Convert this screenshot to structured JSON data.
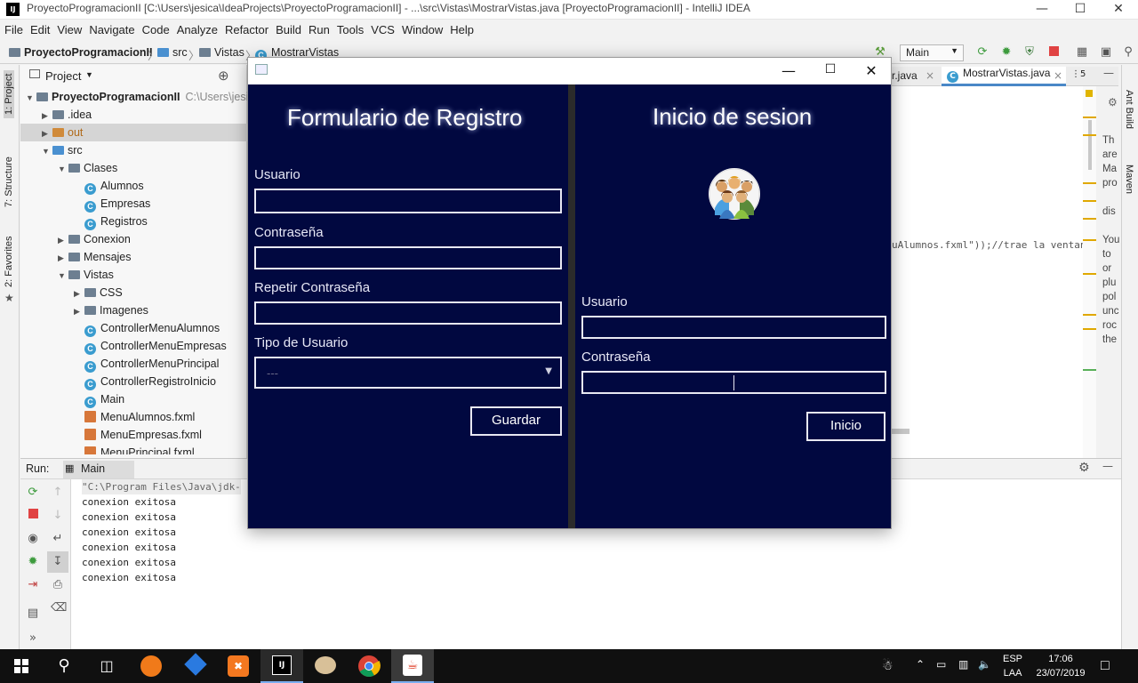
{
  "window": {
    "title": "ProyectoProgramacionII [C:\\Users\\jesica\\IdeaProjects\\ProyectoProgramacionII] - ...\\src\\Vistas\\MostrarVistas.java [ProyectoProgramacionII] - IntelliJ IDEA",
    "app_icon": "IJ"
  },
  "menu": {
    "items": [
      "File",
      "Edit",
      "View",
      "Navigate",
      "Code",
      "Analyze",
      "Refactor",
      "Build",
      "Run",
      "Tools",
      "VCS",
      "Window",
      "Help"
    ]
  },
  "nav": {
    "crumbs": [
      "ProyectoProgramacionII",
      "src",
      "Vistas",
      "MostrarVistas"
    ],
    "run_config": "Main"
  },
  "left_strip": {
    "tabs": [
      "1: Project",
      "7: Structure",
      "2: Favorites"
    ]
  },
  "right_strip": {
    "tabs": [
      "Ant Build",
      "Maven"
    ]
  },
  "project": {
    "header": "Project",
    "tree": [
      {
        "label": "ProyectoProgramacionII",
        "path": "C:\\Users\\jesica",
        "kind": "module",
        "depth": 0,
        "arrow": "▼"
      },
      {
        "label": ".idea",
        "kind": "folder",
        "depth": 1,
        "arrow": "▶"
      },
      {
        "label": "out",
        "kind": "folder-orange",
        "depth": 1,
        "arrow": "▶"
      },
      {
        "label": "src",
        "kind": "folder-blue",
        "depth": 1,
        "arrow": "▼"
      },
      {
        "label": "Clases",
        "kind": "folder",
        "depth": 2,
        "arrow": "▼"
      },
      {
        "label": "Alumnos",
        "kind": "class",
        "depth": 3,
        "arrow": ""
      },
      {
        "label": "Empresas",
        "kind": "class",
        "depth": 3,
        "arrow": ""
      },
      {
        "label": "Registros",
        "kind": "class",
        "depth": 3,
        "arrow": ""
      },
      {
        "label": "Conexion",
        "kind": "folder",
        "depth": 2,
        "arrow": "▶"
      },
      {
        "label": "Mensajes",
        "kind": "folder",
        "depth": 2,
        "arrow": "▶"
      },
      {
        "label": "Vistas",
        "kind": "folder",
        "depth": 2,
        "arrow": "▼"
      },
      {
        "label": "CSS",
        "kind": "folder",
        "depth": 3,
        "arrow": "▶"
      },
      {
        "label": "Imagenes",
        "kind": "folder",
        "depth": 3,
        "arrow": "▶"
      },
      {
        "label": "ControllerMenuAlumnos",
        "kind": "class",
        "depth": 3,
        "arrow": ""
      },
      {
        "label": "ControllerMenuEmpresas",
        "kind": "class",
        "depth": 3,
        "arrow": ""
      },
      {
        "label": "ControllerMenuPrincipal",
        "kind": "class",
        "depth": 3,
        "arrow": ""
      },
      {
        "label": "ControllerRegistroInicio",
        "kind": "class",
        "depth": 3,
        "arrow": ""
      },
      {
        "label": "Main",
        "kind": "class",
        "depth": 3,
        "arrow": ""
      },
      {
        "label": "MenuAlumnos.fxml",
        "kind": "fxml",
        "depth": 3,
        "arrow": ""
      },
      {
        "label": "MenuEmpresas.fxml",
        "kind": "fxml",
        "depth": 3,
        "arrow": ""
      },
      {
        "label": "MenuPrincipal.fxml",
        "kind": "fxml",
        "depth": 3,
        "arrow": ""
      }
    ]
  },
  "editor": {
    "tabs": [
      "r.java",
      "MostrarVistas.java"
    ],
    "tab_overflow": "⋮5",
    "code_line": "uAlumnos.fxml\"));//trae la ventan",
    "right_peek": [
      "Th",
      "are",
      "Ma",
      "pro",
      "",
      "dis",
      "",
      "You",
      "to",
      "or",
      "plu",
      "pol",
      "unc",
      "roc",
      "the"
    ]
  },
  "run": {
    "label": "Run:",
    "tab": "Main",
    "lines": [
      "\"C:\\Program Files\\Java\\jdk-",
      "conexion exitosa",
      "conexion exitosa",
      "conexion exitosa",
      "conexion exitosa",
      "conexion exitosa",
      "conexion exitosa"
    ]
  },
  "dialog": {
    "register": {
      "title": "Formulario de Registro",
      "user_label": "Usuario",
      "pass_label": "Contraseña",
      "repeat_label": "Repetir Contraseña",
      "type_label": "Tipo de Usuario",
      "type_value": "---",
      "save": "Guardar"
    },
    "login": {
      "title": "Inicio de sesion",
      "user_label": "Usuario",
      "pass_label": "Contraseña",
      "button": "Inicio"
    },
    "colors": {
      "bg": "#010840",
      "split": "#2b2b2b",
      "border": "#e8e8f2"
    }
  },
  "taskbar": {
    "lang": "ESP",
    "layout": "LAA",
    "time": "17:06",
    "date": "23/07/2019"
  }
}
